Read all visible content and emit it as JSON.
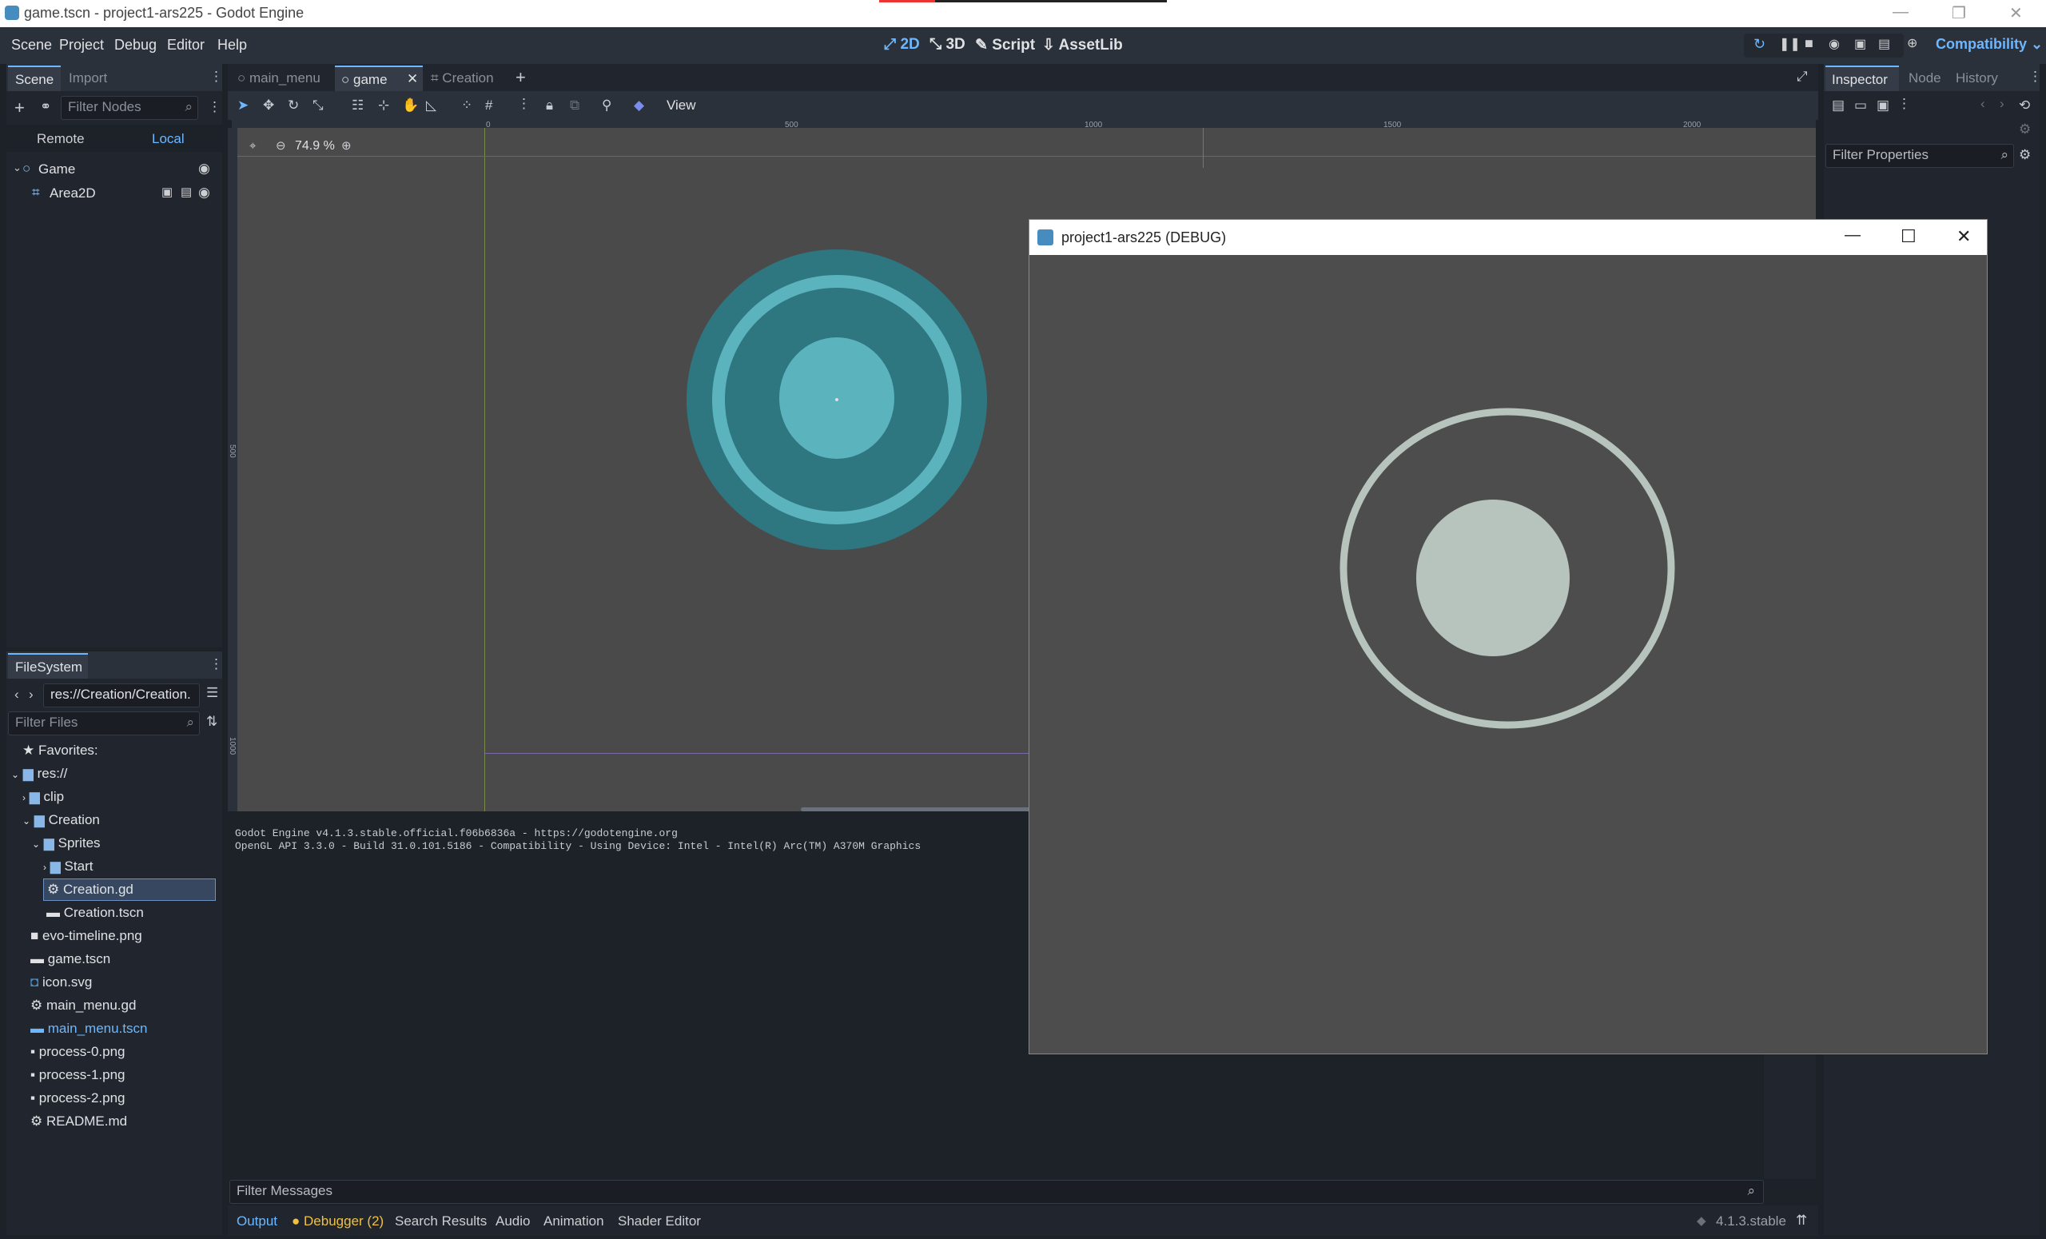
{
  "window": {
    "title": "game.tscn - project1-ars225 - Godot Engine",
    "controls": [
      "—",
      "❐",
      "✕"
    ]
  },
  "menubar": {
    "items": [
      "Scene",
      "Project",
      "Debug",
      "Editor",
      "Help"
    ],
    "workspaces": [
      "2D",
      "3D",
      "Script",
      "AssetLib"
    ],
    "renderer": "Compatibility"
  },
  "scene_dock": {
    "tabs": [
      "Scene",
      "Import"
    ],
    "filter_placeholder": "Filter Nodes",
    "remote": "Remote",
    "local": "Local",
    "nodes": [
      "Game",
      "Area2D"
    ]
  },
  "filesystem": {
    "title": "FileSystem",
    "path": "res://Creation/Creation.",
    "filter_placeholder": "Filter Files",
    "items": [
      {
        "label": "Favorites:",
        "type": "star"
      },
      {
        "label": "res://",
        "type": "folder"
      },
      {
        "label": "clip",
        "type": "folder"
      },
      {
        "label": "Creation",
        "type": "folder"
      },
      {
        "label": "Sprites",
        "type": "folder"
      },
      {
        "label": "Start",
        "type": "folder"
      },
      {
        "label": "Creation.gd",
        "type": "script"
      },
      {
        "label": "Creation.tscn",
        "type": "scene"
      },
      {
        "label": "evo-timeline.png",
        "type": "image"
      },
      {
        "label": "game.tscn",
        "type": "scene"
      },
      {
        "label": "icon.svg",
        "type": "image"
      },
      {
        "label": "main_menu.gd",
        "type": "script"
      },
      {
        "label": "main_menu.tscn",
        "type": "scene"
      },
      {
        "label": "process-0.png",
        "type": "image"
      },
      {
        "label": "process-1.png",
        "type": "image"
      },
      {
        "label": "process-2.png",
        "type": "image"
      },
      {
        "label": "README.md",
        "type": "doc"
      }
    ]
  },
  "editor_tabs": [
    "main_menu",
    "game",
    "Creation"
  ],
  "toolbar": {
    "view": "View",
    "zoom": "74.9 %"
  },
  "rulers": {
    "top": [
      "0",
      "500",
      "1000",
      "1500",
      "2000"
    ],
    "left": [
      "500",
      "1000"
    ]
  },
  "output": {
    "lines": [
      "Godot Engine v4.1.3.stable.official.f06b6836a - https://godotengine.org",
      "OpenGL API 3.3.0 - Build 31.0.101.5186 - Compatibility - Using Device: Intel - Intel(R) Arc(TM) A370M Graphics"
    ],
    "filter_placeholder": "Filter Messages",
    "bottom_tabs": [
      "Output",
      "Debugger (2)",
      "Search Results",
      "Audio",
      "Animation",
      "Shader Editor"
    ],
    "version": "4.1.3.stable"
  },
  "inspector": {
    "tabs": [
      "Inspector",
      "Node",
      "History"
    ],
    "filter_placeholder": "Filter Properties"
  },
  "debug_window": {
    "title": "project1-ars225 (DEBUG)",
    "controls": [
      "—",
      "☐",
      "✕"
    ]
  },
  "colors": {
    "accent": "#6cb7ff",
    "circle_outer": "#2e7680",
    "circle_ring": "#5ab3bd",
    "debug_shape": "#b6c4bd"
  }
}
